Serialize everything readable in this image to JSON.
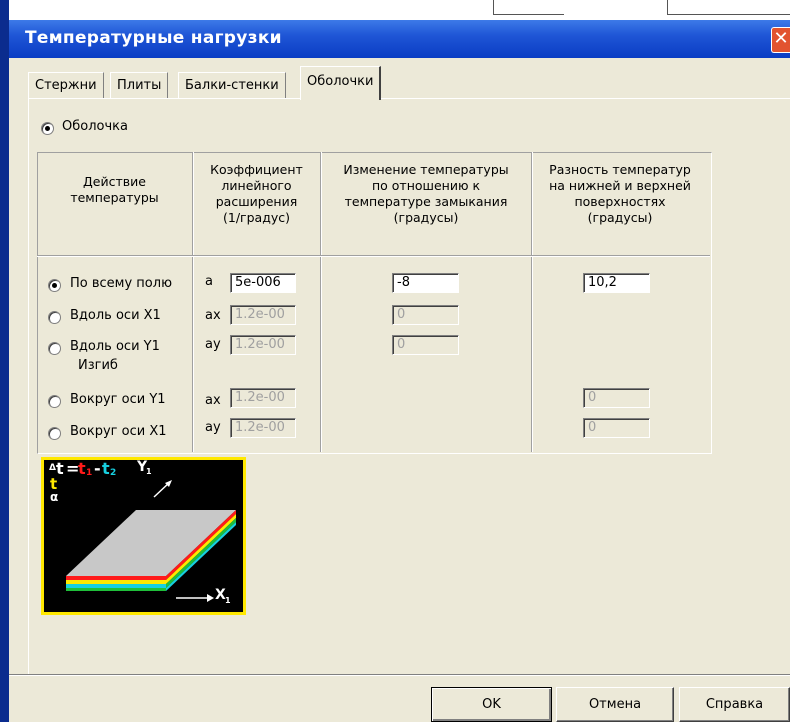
{
  "window": {
    "title": "Температурные нагрузки",
    "close_glyph": "✕"
  },
  "tabs": [
    {
      "label": "Стержни",
      "active": false
    },
    {
      "label": "Плиты",
      "active": false
    },
    {
      "label": "Балки-стенки",
      "active": false
    },
    {
      "label": "Оболочки",
      "active": true
    }
  ],
  "shell_radio": {
    "label": "Оболочка",
    "checked": true
  },
  "table": {
    "headers": {
      "action": "Действие\nтемпературы",
      "coef": "Коэффициент\nлинейного\nрасширения\n(1/градус)",
      "change": "Изменение температуры\nпо отношению к\nтемпературе замыкания\n(градусы)",
      "diff": "Разность температур\nна нижней и верхней\nповерхностях\n(градусы)"
    },
    "bending_label": "Изгиб",
    "rows": [
      {
        "label": "По всему полю",
        "checked": true,
        "coef_sym": "a",
        "coef": "5e-006",
        "change": "-8",
        "diff": "10,2"
      },
      {
        "label": "Вдоль оси X1",
        "checked": false,
        "coef_sym": "ax",
        "coef": "1.2e-00",
        "change": "0"
      },
      {
        "label": "Вдоль оси Y1",
        "checked": false,
        "coef_sym": "ay",
        "coef": "1.2e-00",
        "change": "0"
      },
      {
        "label": "Вокруг оси Y1",
        "checked": false,
        "coef_sym": "ax",
        "coef": "1.2e-00",
        "diff": "0"
      },
      {
        "label": "Вокруг оси X1",
        "checked": false,
        "coef_sym": "ay",
        "coef": "1.2e-00",
        "diff": "0"
      }
    ]
  },
  "diagram": {
    "delta": "Δ",
    "t": "t",
    "eq": "=",
    "t1": "t",
    "t1_sub": "1",
    "minus": "-",
    "t2": "t",
    "t2_sub": "2",
    "y_axis": "Y",
    "y_sub": "1",
    "x_axis": "X",
    "x_sub": "1",
    "t_label": "t",
    "alpha_label": "α",
    "colors": {
      "red": "#ff1a1a",
      "yellow": "#ffe800",
      "cyan": "#17d0e0",
      "green": "#1fbf3a",
      "white": "#ffffff",
      "plate": "#c8c8c8"
    }
  },
  "buttons": {
    "ok": "OK",
    "cancel": "Отмена",
    "help": "Справка"
  }
}
